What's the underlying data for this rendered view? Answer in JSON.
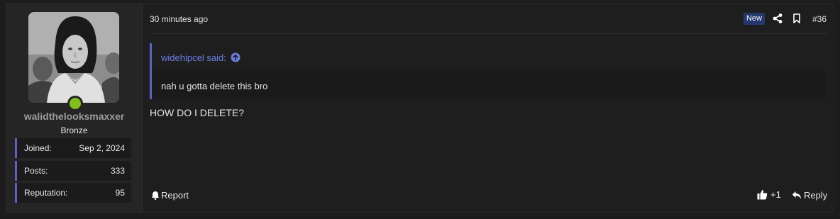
{
  "user": {
    "username": "walidthelooksmaxxer",
    "title": "Bronze",
    "stats": [
      {
        "label": "Joined:",
        "value": "Sep 2, 2024"
      },
      {
        "label": "Posts:",
        "value": "333"
      },
      {
        "label": "Reputation:",
        "value": "95"
      }
    ],
    "online_color": "#7fc01a"
  },
  "post": {
    "time": "30 minutes ago",
    "badge": "New",
    "number": "#36",
    "quote": {
      "author": "widehipcel said:",
      "text": "nah u gotta delete this bro"
    },
    "message": "HOW DO I DELETE?",
    "actions": {
      "report": "Report",
      "like_count": "+1",
      "reply": "Reply"
    }
  },
  "colors": {
    "accent": "#5b63c9",
    "link": "#6a7de0",
    "badge_bg": "#24386e"
  },
  "icons": [
    "share-icon",
    "bookmark-icon",
    "arrow-up-circle-icon",
    "bell-icon",
    "thumbs-up-icon",
    "reply-icon"
  ]
}
